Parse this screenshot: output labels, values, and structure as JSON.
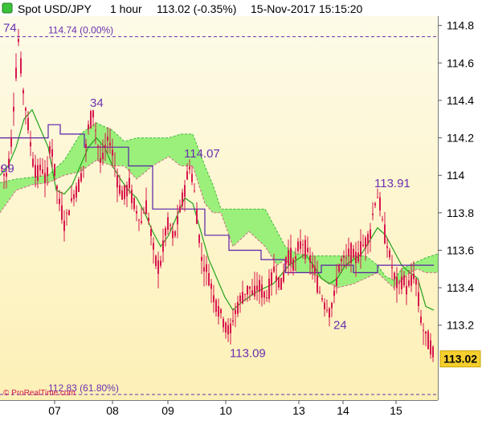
{
  "header": {
    "instrument": "Spot USD/JPY",
    "timeframe": "1 hour",
    "price": "113.02 (-0.35%)",
    "datetime": "15-Nov-2017 15:15:20"
  },
  "watermark": "© ProRealTime.com",
  "colors": {
    "candle": "#d8174d",
    "kumo_bull": "#9af07a",
    "kumo_bear": "#f7b8d4",
    "tenkan": "#23a21a",
    "kijun": "#5a1fa8",
    "annotation": "#6a2fb0",
    "fib_line": "#6a2fb0",
    "plot_bg_top": "#fdfbe8",
    "plot_bg_bottom": "#fdf0b6",
    "last_price_tag": "#f5cf2d"
  },
  "chart_data": {
    "type": "candlestick",
    "instrument": "Spot USD/JPY",
    "interval": "1 hour",
    "x_tick_labels": [
      "07",
      "08",
      "09",
      "10",
      "13",
      "14",
      "15"
    ],
    "y_tick_labels": [
      "114.8",
      "114.6",
      "114.4",
      "114.2",
      "114",
      "113.8",
      "113.6",
      "113.4",
      "113.2"
    ],
    "ylim": [
      112.8,
      114.85
    ],
    "y_ticks": [
      114.8,
      114.6,
      114.4,
      114.2,
      114.0,
      113.8,
      113.6,
      113.4,
      113.2
    ],
    "x_ticks": [
      68,
      140,
      209,
      281,
      372,
      427,
      493
    ],
    "last_price": 113.02,
    "last_price_label": "113.02",
    "fib_levels": [
      {
        "value": 114.74,
        "label": "114.74 (0.00%)"
      },
      {
        "value": 112.83,
        "label": "112.83 (61.80%)"
      }
    ],
    "annotations": [
      {
        "text": "74",
        "x": 4,
        "y": 114.74
      },
      {
        "text": "34",
        "x": 112,
        "y": 114.34
      },
      {
        "text": "114.07",
        "x": 229,
        "y": 114.07
      },
      {
        "text": "99",
        "x": 1,
        "y": 113.99
      },
      {
        "text": "113.91",
        "x": 466,
        "y": 113.91
      },
      {
        "text": "24",
        "x": 415,
        "y": 113.24
      },
      {
        "text": "113.09",
        "x": 286,
        "y": 113.09
      }
    ],
    "series": [
      {
        "name": "",
        "type": "ohlc_path",
        "points": [
          [
            0,
            114.05
          ],
          [
            6,
            113.98
          ],
          [
            12,
            114.12
          ],
          [
            18,
            114.5
          ],
          [
            22,
            114.72
          ],
          [
            27,
            114.48
          ],
          [
            33,
            114.3
          ],
          [
            39,
            114.1
          ],
          [
            45,
            114.0
          ],
          [
            51,
            114.05
          ],
          [
            57,
            113.95
          ],
          [
            62,
            114.2
          ],
          [
            67,
            114.02
          ],
          [
            73,
            113.85
          ],
          [
            79,
            113.75
          ],
          [
            85,
            113.82
          ],
          [
            91,
            113.9
          ],
          [
            97,
            113.95
          ],
          [
            103,
            114.05
          ],
          [
            109,
            114.25
          ],
          [
            115,
            114.34
          ],
          [
            120,
            114.18
          ],
          [
            125,
            114.05
          ],
          [
            130,
            114.15
          ],
          [
            135,
            114.2
          ],
          [
            140,
            114.1
          ],
          [
            145,
            113.98
          ],
          [
            150,
            113.9
          ],
          [
            155,
            113.9
          ],
          [
            160,
            113.95
          ],
          [
            165,
            113.85
          ],
          [
            170,
            113.8
          ],
          [
            175,
            113.75
          ],
          [
            180,
            113.85
          ],
          [
            185,
            113.75
          ],
          [
            190,
            113.6
          ],
          [
            195,
            113.5
          ],
          [
            200,
            113.55
          ],
          [
            205,
            113.7
          ],
          [
            210,
            113.75
          ],
          [
            215,
            113.65
          ],
          [
            220,
            113.75
          ],
          [
            225,
            113.85
          ],
          [
            230,
            113.95
          ],
          [
            235,
            114.05
          ],
          [
            240,
            113.95
          ],
          [
            245,
            113.75
          ],
          [
            250,
            113.55
          ],
          [
            255,
            113.5
          ],
          [
            260,
            113.45
          ],
          [
            265,
            113.35
          ],
          [
            270,
            113.3
          ],
          [
            275,
            113.25
          ],
          [
            280,
            113.2
          ],
          [
            285,
            113.15
          ],
          [
            290,
            113.25
          ],
          [
            295,
            113.3
          ],
          [
            300,
            113.35
          ],
          [
            305,
            113.38
          ],
          [
            310,
            113.4
          ],
          [
            315,
            113.35
          ],
          [
            320,
            113.42
          ],
          [
            325,
            113.38
          ],
          [
            330,
            113.35
          ],
          [
            335,
            113.4
          ],
          [
            340,
            113.5
          ],
          [
            345,
            113.45
          ],
          [
            350,
            113.4
          ],
          [
            355,
            113.55
          ],
          [
            360,
            113.58
          ],
          [
            365,
            113.52
          ],
          [
            370,
            113.6
          ],
          [
            375,
            113.65
          ],
          [
            380,
            113.6
          ],
          [
            385,
            113.55
          ],
          [
            390,
            113.5
          ],
          [
            395,
            113.4
          ],
          [
            400,
            113.35
          ],
          [
            405,
            113.3
          ],
          [
            410,
            113.28
          ],
          [
            415,
            113.35
          ],
          [
            420,
            113.5
          ],
          [
            425,
            113.55
          ],
          [
            430,
            113.55
          ],
          [
            435,
            113.6
          ],
          [
            440,
            113.55
          ],
          [
            445,
            113.58
          ],
          [
            450,
            113.62
          ],
          [
            455,
            113.65
          ],
          [
            460,
            113.7
          ],
          [
            465,
            113.85
          ],
          [
            470,
            113.9
          ],
          [
            475,
            113.75
          ],
          [
            480,
            113.65
          ],
          [
            485,
            113.55
          ],
          [
            490,
            113.45
          ],
          [
            495,
            113.4
          ],
          [
            500,
            113.45
          ],
          [
            505,
            113.4
          ],
          [
            510,
            113.42
          ],
          [
            515,
            113.48
          ],
          [
            518,
            113.4
          ],
          [
            521,
            113.3
          ],
          [
            524,
            113.2
          ],
          [
            528,
            113.15
          ],
          [
            532,
            113.12
          ],
          [
            536,
            113.08
          ],
          [
            539,
            113.02
          ]
        ]
      },
      {
        "name": "",
        "type": "line",
        "role": "tenkan",
        "points": [
          [
            0,
            114.0
          ],
          [
            10,
            114.05
          ],
          [
            20,
            114.15
          ],
          [
            30,
            114.3
          ],
          [
            40,
            114.35
          ],
          [
            50,
            114.25
          ],
          [
            60,
            114.15
          ],
          [
            70,
            113.92
          ],
          [
            80,
            113.9
          ],
          [
            90,
            113.95
          ],
          [
            100,
            114.05
          ],
          [
            110,
            114.15
          ],
          [
            120,
            114.2
          ],
          [
            130,
            114.15
          ],
          [
            140,
            114.05
          ],
          [
            150,
            113.98
          ],
          [
            160,
            113.92
          ],
          [
            170,
            113.88
          ],
          [
            180,
            113.8
          ],
          [
            190,
            113.7
          ],
          [
            200,
            113.62
          ],
          [
            210,
            113.68
          ],
          [
            220,
            113.78
          ],
          [
            230,
            113.88
          ],
          [
            240,
            113.85
          ],
          [
            250,
            113.7
          ],
          [
            260,
            113.55
          ],
          [
            270,
            113.45
          ],
          [
            280,
            113.35
          ],
          [
            290,
            113.28
          ],
          [
            300,
            113.32
          ],
          [
            310,
            113.35
          ],
          [
            320,
            113.38
          ],
          [
            330,
            113.4
          ],
          [
            340,
            113.42
          ],
          [
            350,
            113.47
          ],
          [
            360,
            113.52
          ],
          [
            370,
            113.55
          ],
          [
            380,
            113.58
          ],
          [
            390,
            113.52
          ],
          [
            400,
            113.45
          ],
          [
            410,
            113.42
          ],
          [
            420,
            113.45
          ],
          [
            430,
            113.52
          ],
          [
            440,
            113.55
          ],
          [
            450,
            113.58
          ],
          [
            460,
            113.65
          ],
          [
            470,
            113.72
          ],
          [
            480,
            113.68
          ],
          [
            490,
            113.6
          ],
          [
            500,
            113.52
          ],
          [
            510,
            113.48
          ],
          [
            520,
            113.45
          ],
          [
            530,
            113.3
          ],
          [
            540,
            113.28
          ]
        ]
      },
      {
        "name": "",
        "type": "step",
        "role": "kijun",
        "points": [
          [
            0,
            114.2
          ],
          [
            60,
            114.2
          ],
          [
            60,
            114.27
          ],
          [
            75,
            114.27
          ],
          [
            75,
            114.22
          ],
          [
            105,
            114.22
          ],
          [
            105,
            114.15
          ],
          [
            160,
            114.15
          ],
          [
            160,
            114.05
          ],
          [
            190,
            114.05
          ],
          [
            190,
            113.82
          ],
          [
            255,
            113.82
          ],
          [
            255,
            113.68
          ],
          [
            285,
            113.68
          ],
          [
            285,
            113.6
          ],
          [
            325,
            113.6
          ],
          [
            325,
            113.55
          ],
          [
            355,
            113.55
          ],
          [
            355,
            113.48
          ],
          [
            400,
            113.48
          ],
          [
            400,
            113.52
          ],
          [
            440,
            113.52
          ],
          [
            440,
            113.48
          ],
          [
            470,
            113.48
          ],
          [
            470,
            113.52
          ],
          [
            540,
            113.52
          ]
        ]
      },
      {
        "name": "",
        "type": "area_band",
        "role": "kumo",
        "upper": [
          [
            0,
            113.96
          ],
          [
            20,
            113.98
          ],
          [
            40,
            113.99
          ],
          [
            60,
            114.0
          ],
          [
            80,
            114.08
          ],
          [
            100,
            114.22
          ],
          [
            120,
            114.28
          ],
          [
            140,
            114.24
          ],
          [
            155,
            114.18
          ],
          [
            170,
            114.2
          ],
          [
            190,
            114.2
          ],
          [
            210,
            114.2
          ],
          [
            225,
            114.22
          ],
          [
            240,
            114.22
          ],
          [
            255,
            114.05
          ],
          [
            265,
            113.95
          ],
          [
            275,
            113.82
          ],
          [
            290,
            113.82
          ],
          [
            310,
            113.82
          ],
          [
            330,
            113.82
          ],
          [
            345,
            113.7
          ],
          [
            355,
            113.62
          ],
          [
            370,
            113.58
          ],
          [
            385,
            113.57
          ],
          [
            400,
            113.57
          ],
          [
            420,
            113.57
          ],
          [
            440,
            113.57
          ],
          [
            455,
            113.57
          ],
          [
            470,
            113.52
          ],
          [
            480,
            113.46
          ],
          [
            490,
            113.44
          ],
          [
            500,
            113.5
          ],
          [
            510,
            113.52
          ],
          [
            520,
            113.54
          ],
          [
            530,
            113.56
          ],
          [
            545,
            113.58
          ]
        ],
        "lower": [
          [
            0,
            113.8
          ],
          [
            20,
            113.92
          ],
          [
            40,
            113.95
          ],
          [
            60,
            113.96
          ],
          [
            80,
            114.0
          ],
          [
            100,
            114.02
          ],
          [
            120,
            114.08
          ],
          [
            140,
            114.05
          ],
          [
            155,
            114.05
          ],
          [
            170,
            113.98
          ],
          [
            190,
            114.05
          ],
          [
            210,
            114.1
          ],
          [
            225,
            114.05
          ],
          [
            240,
            114.05
          ],
          [
            255,
            113.85
          ],
          [
            265,
            113.8
          ],
          [
            275,
            113.8
          ],
          [
            290,
            113.62
          ],
          [
            310,
            113.7
          ],
          [
            330,
            113.62
          ],
          [
            345,
            113.52
          ],
          [
            355,
            113.55
          ],
          [
            370,
            113.48
          ],
          [
            385,
            113.48
          ],
          [
            400,
            113.45
          ],
          [
            420,
            113.4
          ],
          [
            440,
            113.42
          ],
          [
            455,
            113.45
          ],
          [
            470,
            113.48
          ],
          [
            480,
            113.44
          ],
          [
            490,
            113.4
          ],
          [
            500,
            113.44
          ],
          [
            510,
            113.48
          ],
          [
            520,
            113.5
          ],
          [
            530,
            113.48
          ],
          [
            545,
            113.48
          ]
        ]
      }
    ]
  }
}
